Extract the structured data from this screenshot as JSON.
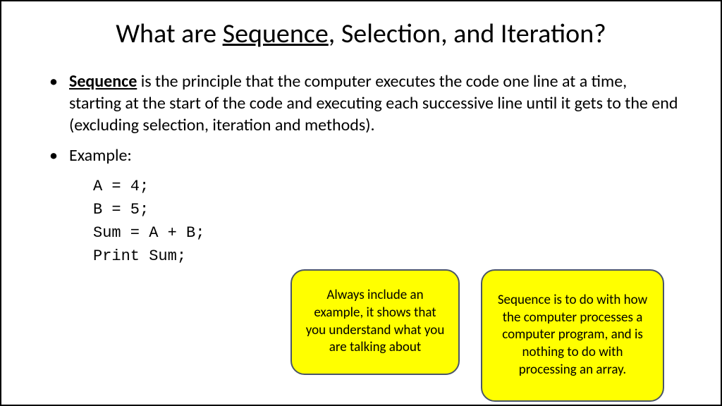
{
  "title": {
    "pre": "What are ",
    "underlined": "Sequence",
    "post": ", Selection, and Iteration?"
  },
  "bullet1": {
    "lead": "Sequence",
    "rest": " is the principle that the computer executes the code one line at a time, starting at the start of the code and executing each successive line until it gets to the end (excluding selection, iteration and methods)."
  },
  "bullet2": "Example:",
  "code": {
    "l1": "A = 4;",
    "l2": "B = 5;",
    "l3": "Sum = A + B;",
    "l4": "Print Sum;"
  },
  "callouts": {
    "c1": "Always include an example, it shows that you understand what you are talking about",
    "c2": "Sequence is to do with how the computer processes a computer program, and is nothing to do with processing an array."
  }
}
